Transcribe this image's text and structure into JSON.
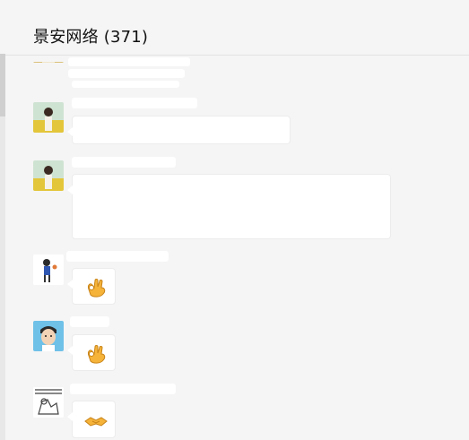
{
  "header": {
    "title": "景安网络 (371)"
  },
  "messages": [
    {
      "kind": "text",
      "avatar": "photo-avatar"
    },
    {
      "kind": "text",
      "avatar": "photo-avatar"
    },
    {
      "kind": "text",
      "avatar": "photo-avatar"
    },
    {
      "kind": "sticker",
      "avatar": "cartoon-boy-avatar",
      "sticker": "ok-hand-emoji"
    },
    {
      "kind": "sticker",
      "avatar": "cartoon-face-avatar",
      "sticker": "ok-hand-emoji"
    },
    {
      "kind": "sticker",
      "avatar": "sketch-avatar",
      "sticker": "handshake-emoji"
    }
  ],
  "colors": {
    "background": "#f5f5f5",
    "bubble": "#ffffff",
    "emoji": "#f5b33a",
    "accent": "#2b2f8a"
  }
}
